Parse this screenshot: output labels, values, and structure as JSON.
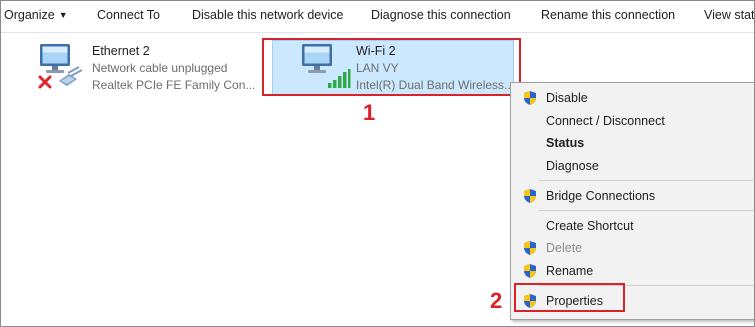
{
  "toolbar": {
    "organize": "Organize",
    "organize_arrow": "▼",
    "connect_to": "Connect To",
    "disable_device": "Disable this network device",
    "diagnose": "Diagnose this connection",
    "rename": "Rename this connection",
    "view_status": "View status of this connection"
  },
  "adapters": {
    "ethernet": {
      "name": "Ethernet 2",
      "status": "Network cable unplugged",
      "device": "Realtek PCIe FE Family Con...",
      "icon": "ethernet-adapter-icon",
      "overlay_icon": "red-x-disconnected-icon"
    },
    "wifi": {
      "name": "Wi-Fi 2",
      "network": "LAN VY",
      "device": "Intel(R) Dual Band Wireless...",
      "icon": "wifi-adapter-icon",
      "overlay_icon": "signal-bars-icon",
      "selected": true
    }
  },
  "context_menu": {
    "items": [
      {
        "label": "Disable",
        "shield": true,
        "bold": false,
        "disabled": false
      },
      {
        "label": "Connect / Disconnect",
        "shield": false,
        "bold": false,
        "disabled": false
      },
      {
        "label": "Status",
        "shield": false,
        "bold": true,
        "disabled": false
      },
      {
        "label": "Diagnose",
        "shield": false,
        "bold": false,
        "disabled": false
      },
      {
        "label": "Bridge Connections",
        "shield": true,
        "bold": false,
        "disabled": false
      },
      {
        "label": "Create Shortcut",
        "shield": false,
        "bold": false,
        "disabled": false
      },
      {
        "label": "Delete",
        "shield": true,
        "bold": false,
        "disabled": true
      },
      {
        "label": "Rename",
        "shield": true,
        "bold": false,
        "disabled": false
      },
      {
        "label": "Properties",
        "shield": true,
        "bold": false,
        "disabled": false
      }
    ]
  },
  "annotations": {
    "step1": "1",
    "step2": "2",
    "highlight_color": "#d9232b"
  },
  "colors": {
    "selection_fill": "#cce8ff",
    "selection_border": "#99d1ff",
    "menu_bg": "#f2f2f2"
  }
}
